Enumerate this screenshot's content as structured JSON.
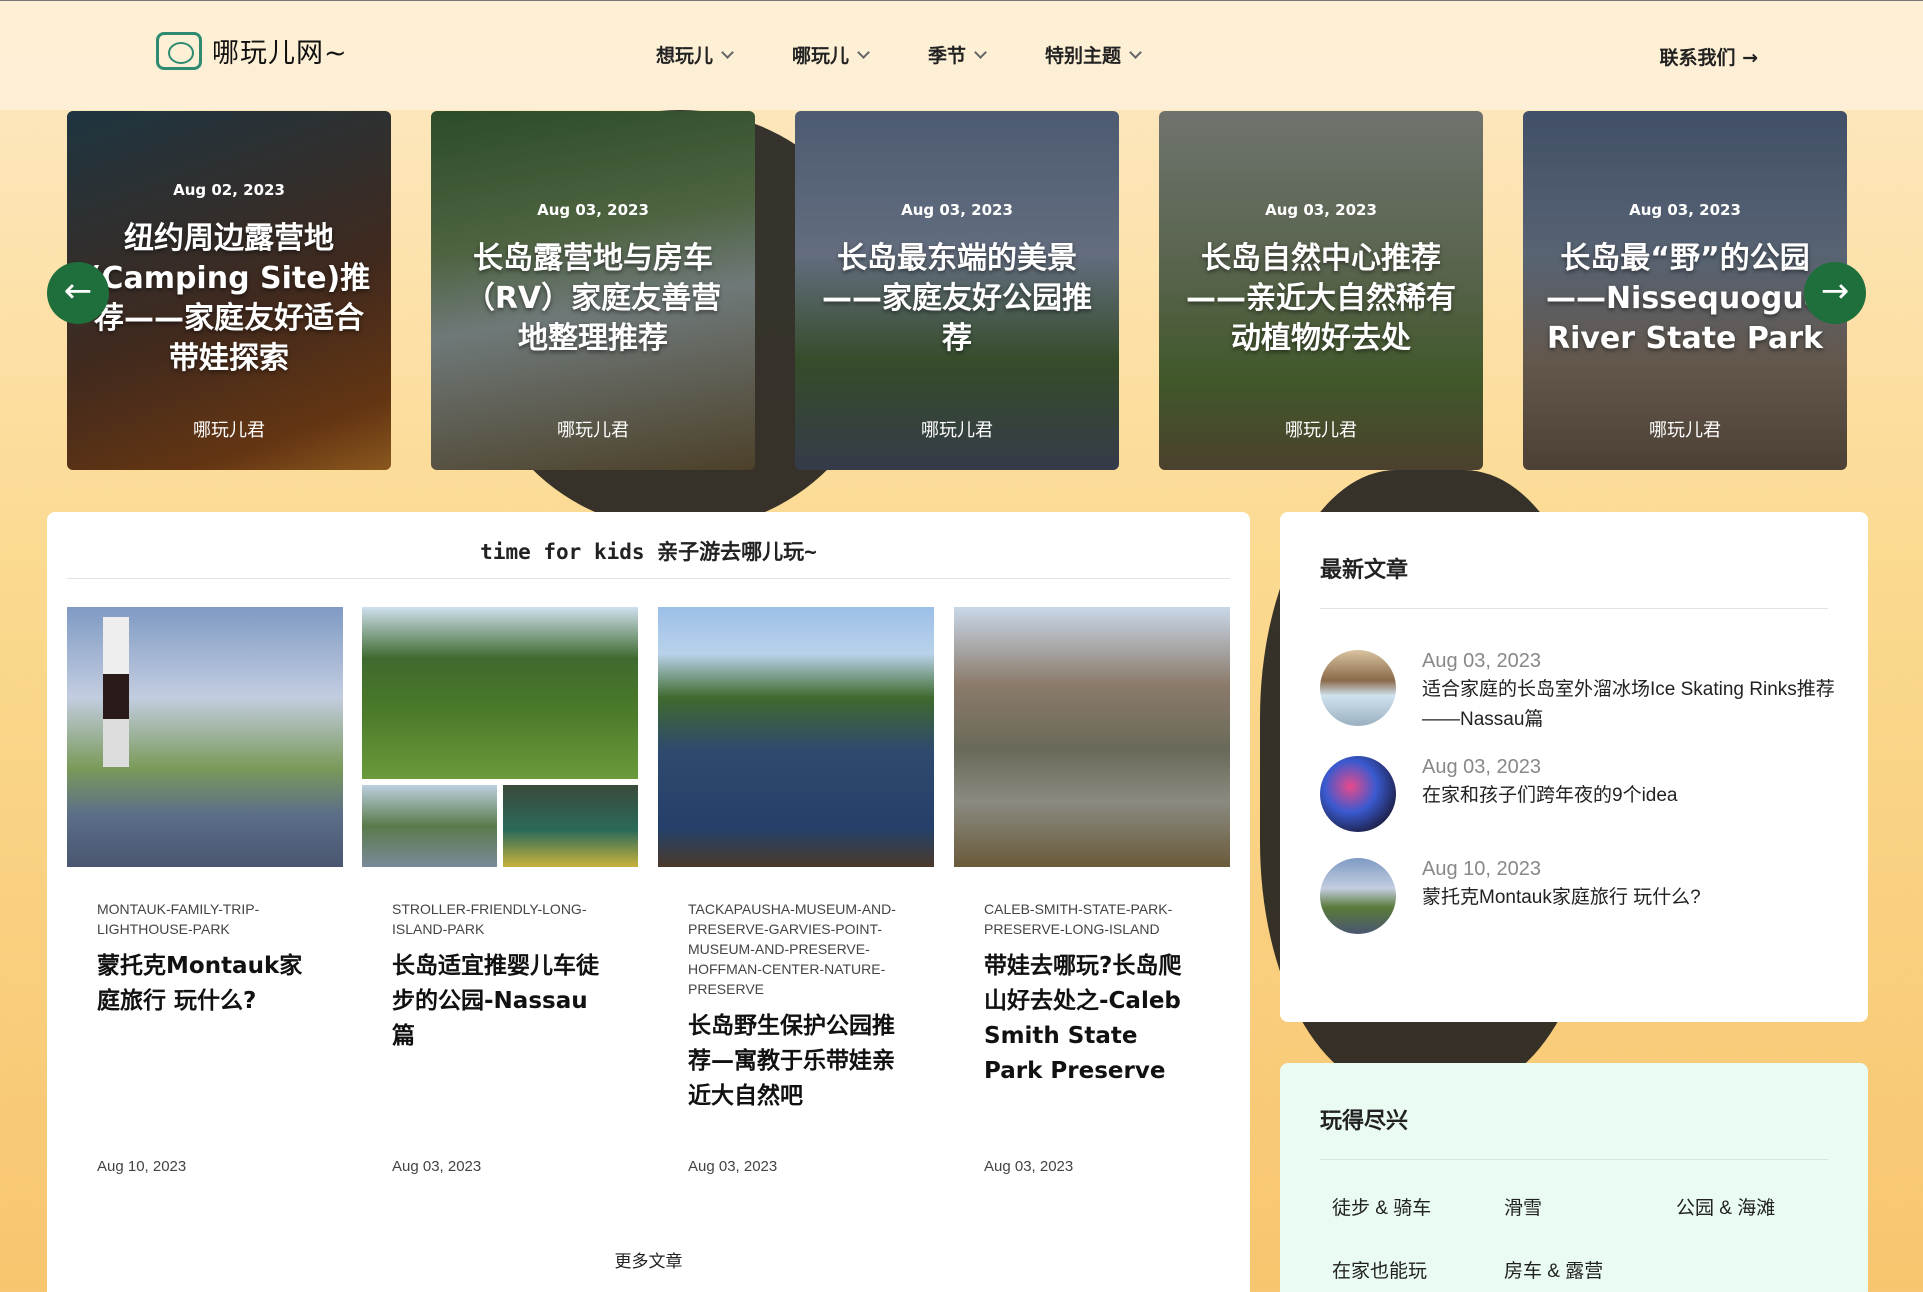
{
  "header": {
    "logo_text": "哪玩儿网~",
    "nav": [
      {
        "label": "想玩儿"
      },
      {
        "label": "哪玩儿"
      },
      {
        "label": "季节"
      },
      {
        "label": "特别主题"
      }
    ],
    "contact": "联系我们 →"
  },
  "carousel": {
    "prev_icon": "←",
    "next_icon": "→",
    "slides": [
      {
        "date": "Aug 02, 2023",
        "title": "纽约周边露营地(Camping Site)推荐——家庭友好适合带娃探索",
        "author": "哪玩儿君"
      },
      {
        "date": "Aug 03, 2023",
        "title": "长岛露营地与房车（RV）家庭友善营地整理推荐",
        "author": "哪玩儿君"
      },
      {
        "date": "Aug 03, 2023",
        "title": "长岛最东端的美景——家庭友好公园推荐",
        "author": "哪玩儿君"
      },
      {
        "date": "Aug 03, 2023",
        "title": "长岛自然中心推荐——亲近大自然稀有动植物好去处",
        "author": "哪玩儿君"
      },
      {
        "date": "Aug 03, 2023",
        "title": "长岛最“野”的公园——Nissequogue River State Park",
        "author": "哪玩儿君"
      }
    ]
  },
  "main": {
    "section_title": "time for kids 亲子游去哪儿玩~",
    "posts": [
      {
        "slug": "MONTAUK-FAMILY-TRIP-LIGHTHOUSE-PARK",
        "title": "蒙托克Montauk家庭旅行 玩什么?",
        "date": "Aug 10, 2023"
      },
      {
        "slug": "STROLLER-FRIENDLY-LONG-ISLAND-PARK",
        "title": "长岛适宜推婴儿车徒步的公园-Nassau篇",
        "date": "Aug 03, 2023"
      },
      {
        "slug": "TACKAPAUSHA-MUSEUM-AND-PRESERVE-GARVIES-POINT-MUSEUM-AND-PRESERVE-HOFFMAN-CENTER-NATURE-PRESERVE",
        "title": "长岛野生保护公园推荐—寓教于乐带娃亲近大自然吧",
        "date": "Aug 03, 2023"
      },
      {
        "slug": "CALEB-SMITH-STATE-PARK-PRESERVE-LONG-ISLAND",
        "title": "带娃去哪玩?长岛爬山好去处之-Caleb Smith State Park Preserve",
        "date": "Aug 03, 2023"
      }
    ],
    "more_label": "更多文章"
  },
  "sidebar": {
    "recent_title": "最新文章",
    "recent": [
      {
        "date": "Aug 03, 2023",
        "title": "适合家庭的长岛室外溜冰场Ice Skating Rinks推荐——Nassau篇"
      },
      {
        "date": "Aug 03, 2023",
        "title": "在家和孩子们跨年夜的9个idea"
      },
      {
        "date": "Aug 10, 2023",
        "title": "蒙托克Montauk家庭旅行 玩什么?"
      }
    ],
    "categories_title": "玩得尽兴",
    "categories": [
      "徒步 & 骑车",
      "滑雪",
      "公园 & 海滩",
      "在家也能玩",
      "房车 & 露营"
    ]
  },
  "colors": {
    "accent": "#1f6f3c",
    "logo": "#2e8b72",
    "category_bg": "#eafbf2"
  }
}
